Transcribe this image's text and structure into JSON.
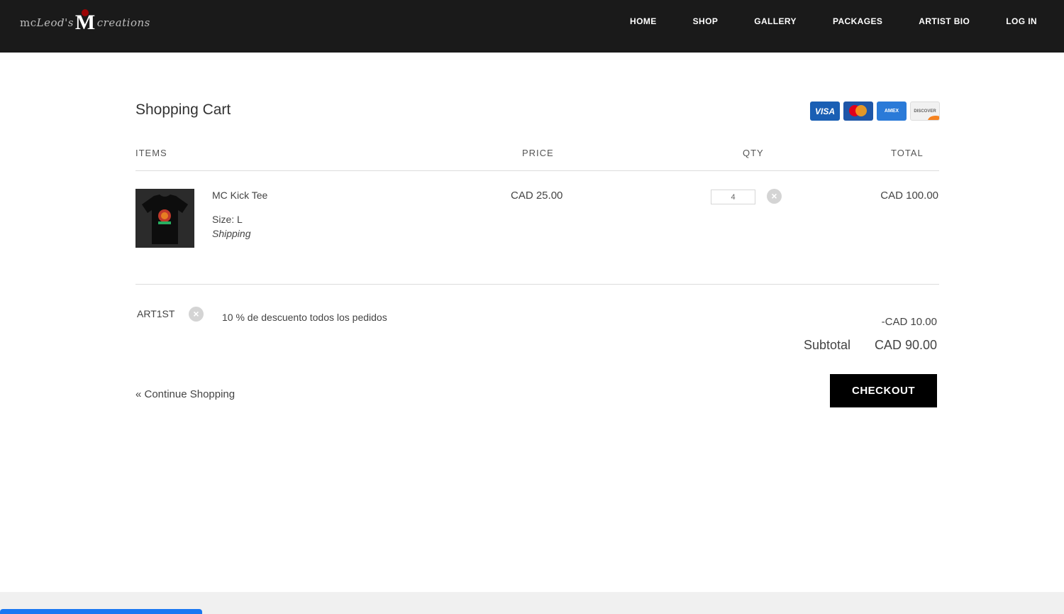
{
  "header": {
    "logo": {
      "left": "mc",
      "script": "Leod's",
      "mark": "M",
      "right": "creations"
    },
    "nav": [
      "HOME",
      "SHOP",
      "GALLERY",
      "PACKAGES",
      "ARTIST BIO",
      "LOG IN"
    ]
  },
  "cart": {
    "title": "Shopping Cart",
    "cards": {
      "visa": "VISA",
      "amex": "AMEX",
      "discover": "DISCOVER"
    },
    "columns": {
      "items": "ITEMS",
      "price": "PRICE",
      "qty": "QTY",
      "total": "TOTAL"
    },
    "item": {
      "name": "MC Kick Tee",
      "size": "Size: L",
      "shipping": "Shipping",
      "price": "CAD 25.00",
      "qty": "4",
      "total": "CAD 100.00"
    },
    "coupon": {
      "code": "ART1ST",
      "description": "10 % de descuento todos los pedidos",
      "discount": "-CAD 10.00"
    },
    "subtotal_label": "Subtotal",
    "subtotal_value": "CAD 90.00",
    "continue_label": "« Continue Shopping",
    "checkout_label": "CHECKOUT"
  },
  "colors": {
    "header_bg": "#1a1a1a",
    "button_bg": "#000000",
    "accent": "#1877f2"
  }
}
